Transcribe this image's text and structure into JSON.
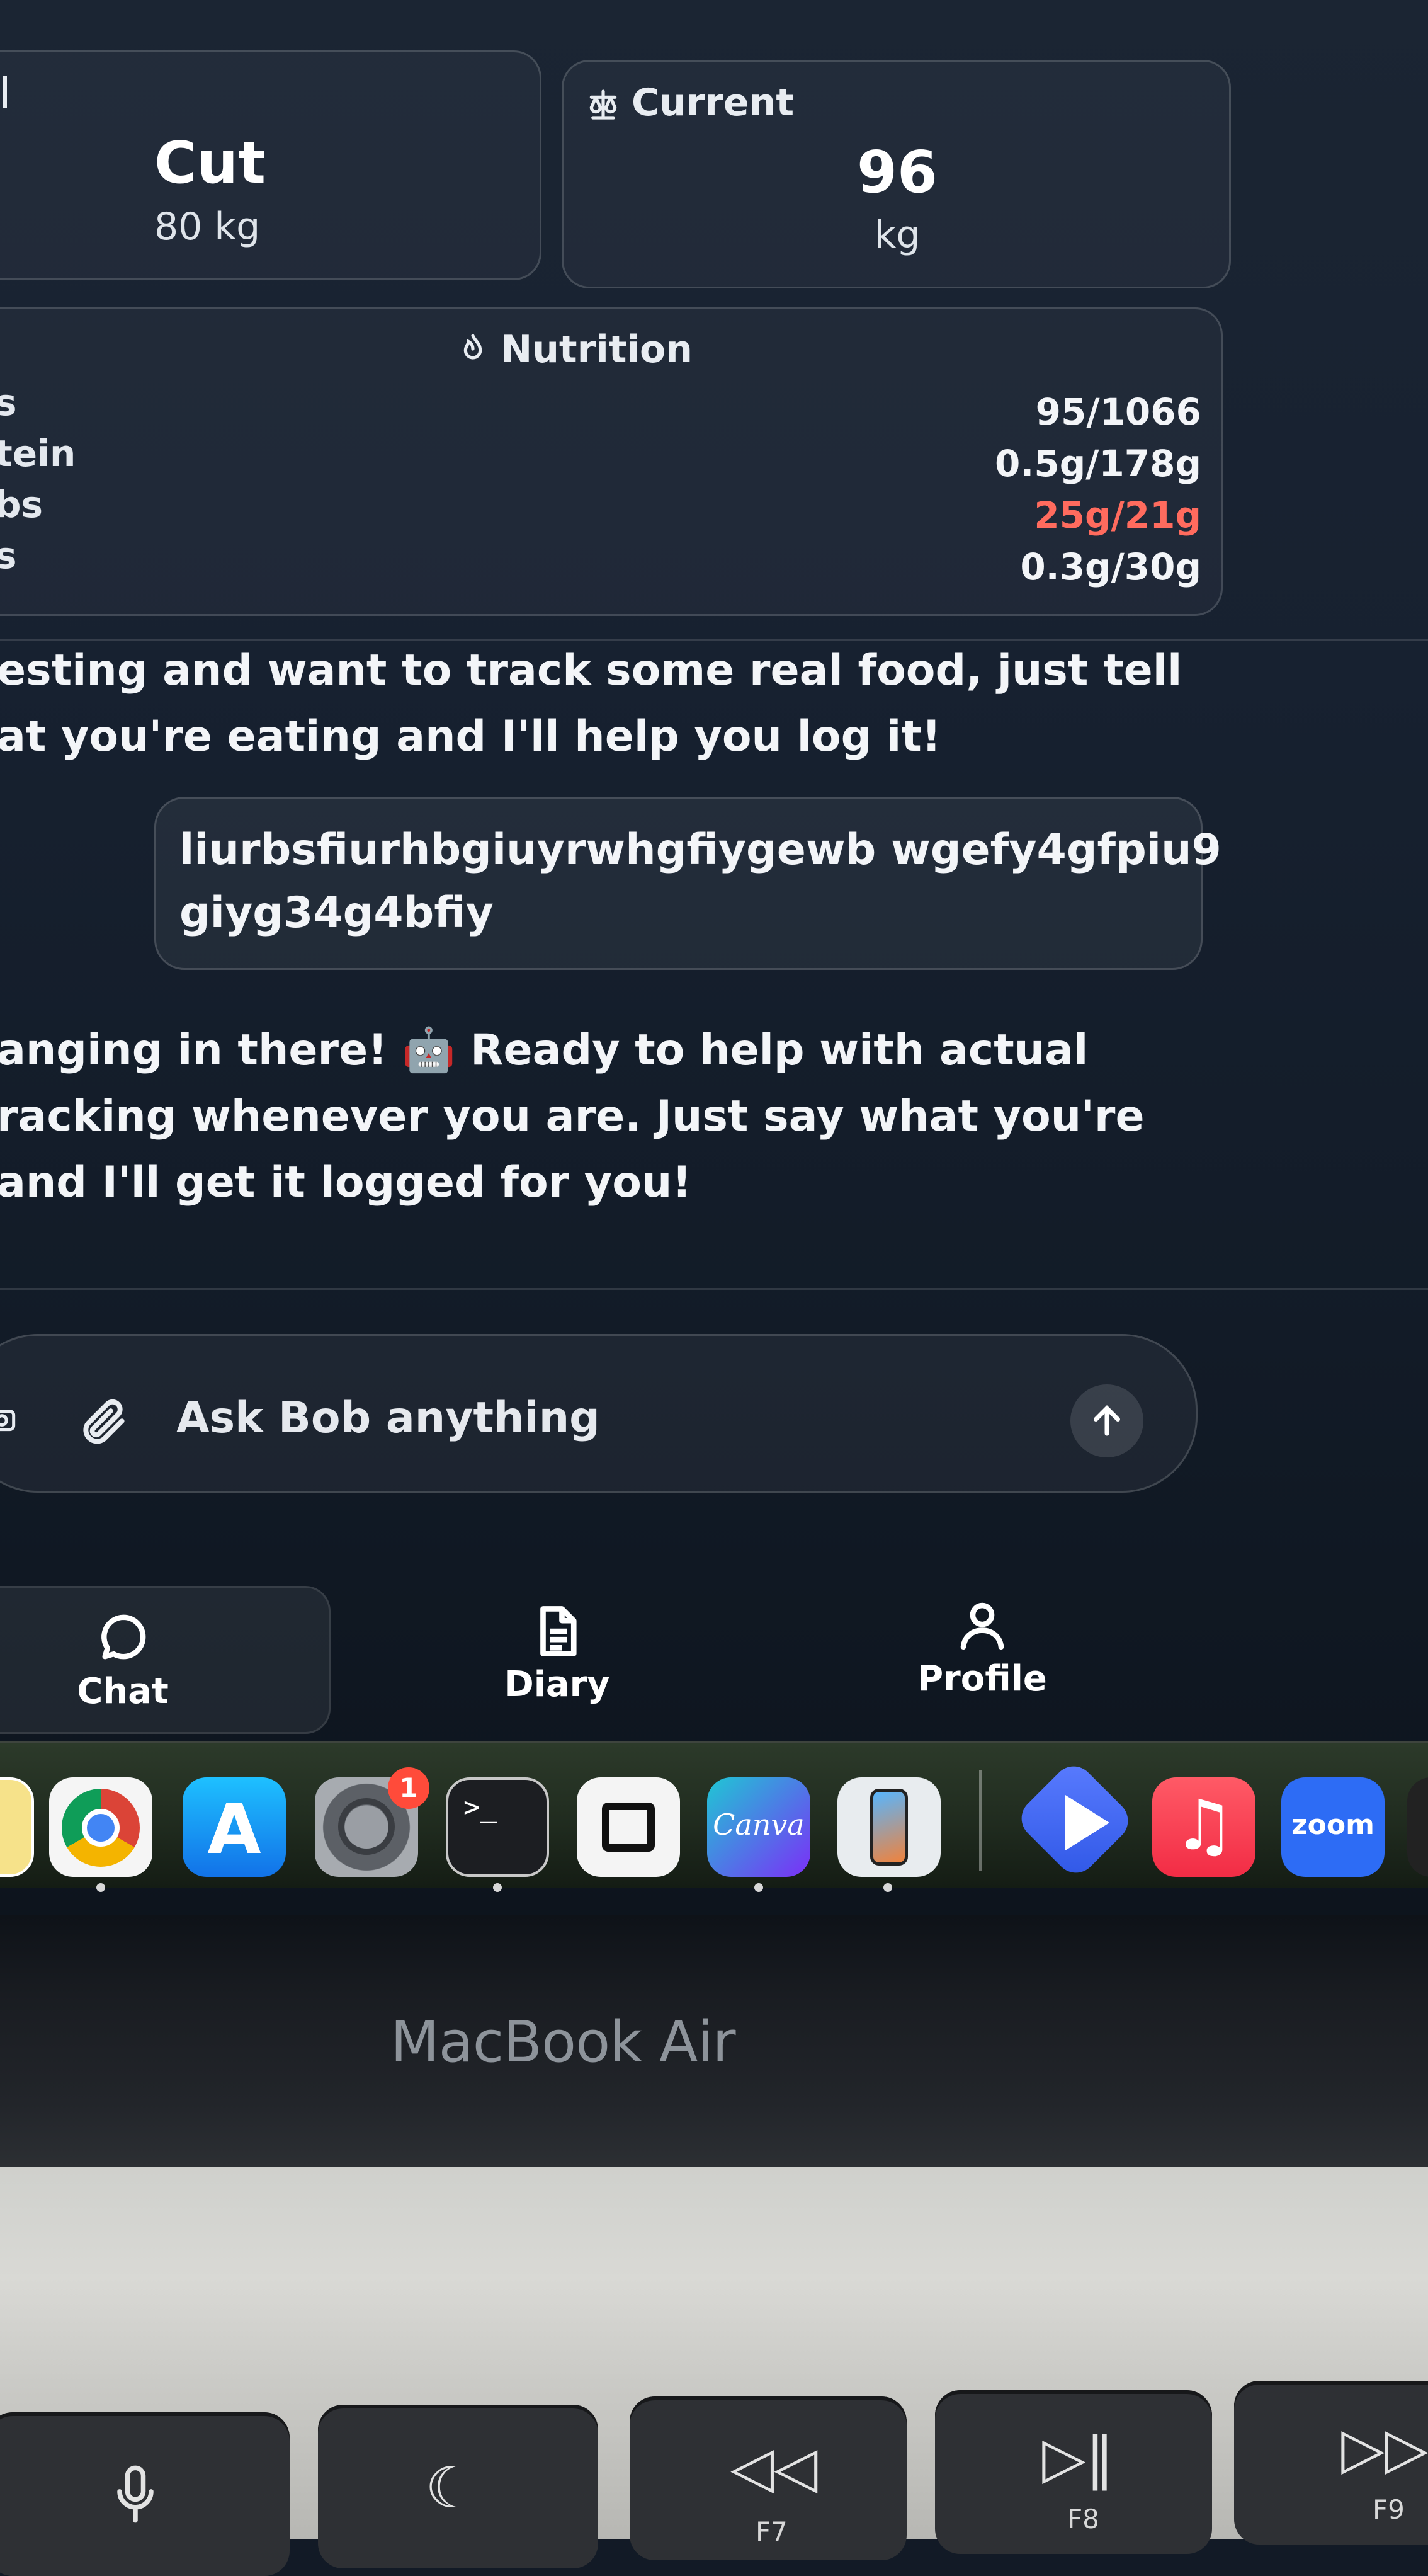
{
  "goal_card": {
    "title": "Cut",
    "value": "80 kg"
  },
  "current_card": {
    "label": "Current",
    "value": "96",
    "unit": "kg"
  },
  "nutrition": {
    "label": "Nutrition",
    "rows": [
      {
        "name": "s",
        "value": "95/1066",
        "color": "#f3f5f8"
      },
      {
        "name": "tein",
        "value": "0.5g/178g",
        "color": "#f3f5f8"
      },
      {
        "name": "bs",
        "value": "25g/21g",
        "color": "#ff6b5e"
      },
      {
        "name": "s",
        "value": "0.3g/30g",
        "color": "#f3f5f8"
      }
    ]
  },
  "chat": {
    "assistant_message_1": [
      "esting and want to track some real food, just tell",
      "at you're eating and I'll help you log it!"
    ],
    "user_message": [
      "liurbsfiurhbgiuyrwhgfiygewb wgefy4gfpiu9",
      "giyg34g4bfiy"
    ],
    "assistant_message_2": [
      "anging in there! 🤖 Ready to help with actual",
      "racking whenever you are. Just say what you're",
      "and I'll get it logged for you!"
    ]
  },
  "composer": {
    "placeholder": "Ask Bob anything"
  },
  "tabs": [
    {
      "label": "Chat",
      "icon": "chat-bubble-icon",
      "active": true
    },
    {
      "label": "Diary",
      "icon": "document-icon",
      "active": false
    },
    {
      "label": "Profile",
      "icon": "person-icon",
      "active": false
    }
  ],
  "dock": {
    "apps": [
      "notes",
      "chrome",
      "app-store",
      "system-settings",
      "terminal",
      "capcut",
      "canva",
      "iphone-mirroring",
      "prime-video",
      "music",
      "zoom"
    ],
    "settings_badge": "1",
    "canva_label": "Canva",
    "zoom_label": "zoom"
  },
  "device_label": "MacBook Air",
  "keys": [
    {
      "label": "",
      "icon": "microphone-icon"
    },
    {
      "label": "",
      "icon": "moon-icon"
    },
    {
      "label": "F7",
      "icon": "rewind-icon"
    },
    {
      "label": "F8",
      "icon": "play-pause-icon"
    },
    {
      "label": "F9",
      "icon": "fast-forward-icon"
    }
  ],
  "colors": {
    "over_limit": "#ff6b5e",
    "background": "#172130",
    "dock_zoom": "#2d6cf5",
    "badge": "#ff4b3a"
  }
}
